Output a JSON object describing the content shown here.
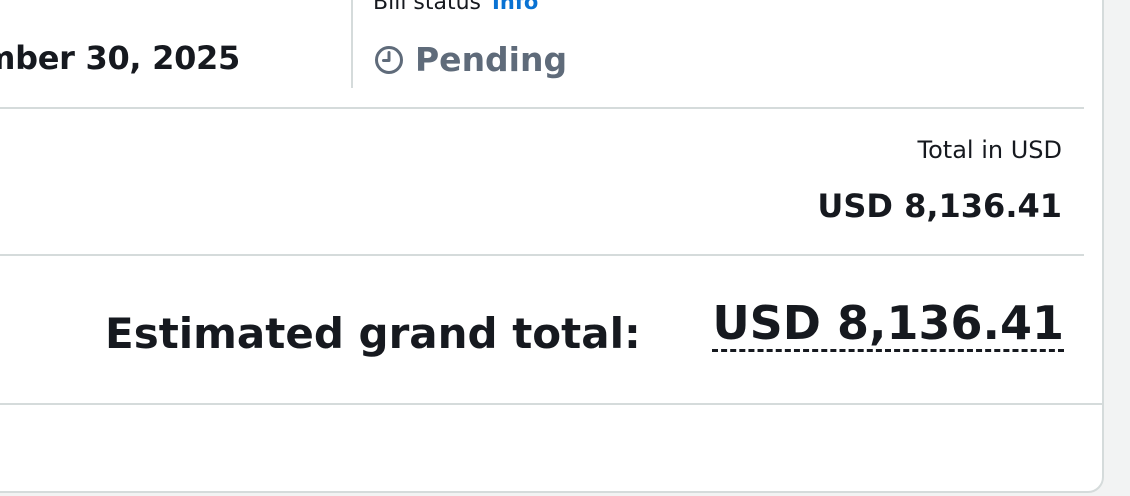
{
  "billing_period": {
    "end_date_partial": "mber 30, 2025"
  },
  "bill_status": {
    "label": "Bill status",
    "info_link": "Info",
    "value": "Pending",
    "icon": "clock-icon"
  },
  "totals": {
    "currency_header": "Total in USD",
    "amount": "USD 8,136.41"
  },
  "grand_total": {
    "label": "Estimated grand total:",
    "amount": "USD 8,136.41"
  },
  "colors": {
    "link": "#0972d3",
    "text": "#16191f",
    "muted": "#5f6b7a",
    "divider": "#d5dbdb"
  }
}
